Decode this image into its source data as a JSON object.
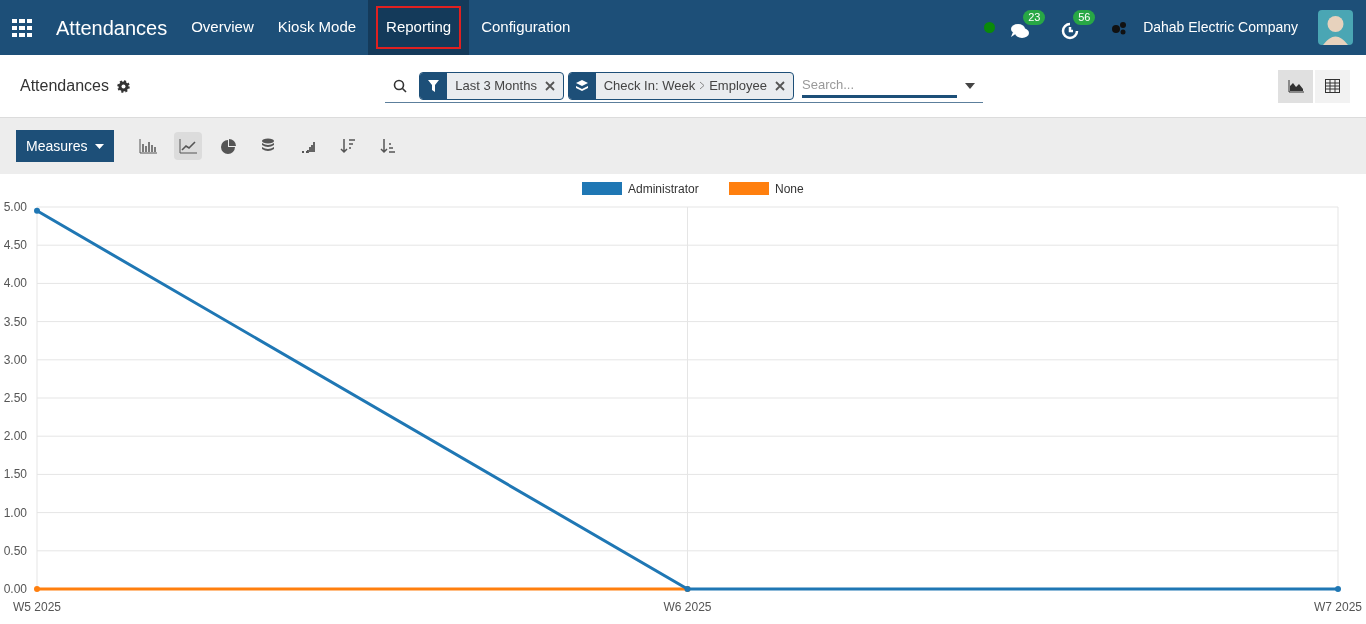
{
  "navbar": {
    "app_title": "Attendances",
    "menu": [
      {
        "label": "Overview",
        "selected": false
      },
      {
        "label": "Kiosk Mode",
        "selected": false
      },
      {
        "label": "Reporting",
        "selected": true
      },
      {
        "label": "Configuration",
        "selected": false
      }
    ],
    "messages_count": "23",
    "activities_count": "56",
    "company": "Dahab Electric Company"
  },
  "control_panel": {
    "breadcrumb": "Attendances",
    "facets": [
      {
        "kind": "filter",
        "label": "Last 3 Months"
      },
      {
        "kind": "groupby",
        "label": "Check In: Week",
        "sub": "Employee"
      }
    ],
    "search": {
      "placeholder": "Search..."
    },
    "views": [
      {
        "kind": "graph",
        "selected": true
      },
      {
        "kind": "pivot",
        "selected": false
      }
    ]
  },
  "toolbar": {
    "measures": "Measures",
    "modes": [
      {
        "kind": "bar",
        "selected": false
      },
      {
        "kind": "line",
        "selected": true
      },
      {
        "kind": "pie",
        "selected": false
      }
    ]
  },
  "chart": {
    "chart_data": {
      "type": "line",
      "grid": true,
      "legend": true,
      "categories": [
        "W5 2025",
        "W6 2025",
        "W7 2025"
      ],
      "series": [
        {
          "name": "Administrator",
          "color": "#1f77b4",
          "marker": "circle",
          "values": [
            4.95,
            0,
            0
          ]
        },
        {
          "name": "None",
          "color": "#ff7f0e",
          "marker": "circle",
          "values": [
            0,
            0,
            null
          ]
        }
      ],
      "ylim": [
        0,
        5
      ],
      "yticks": [
        {
          "value": 0,
          "label": "0.00"
        },
        {
          "value": 0.5,
          "label": "0.50"
        },
        {
          "value": 1,
          "label": "1.00"
        },
        {
          "value": 1.5,
          "label": "1.50"
        },
        {
          "value": 2,
          "label": "2.00"
        },
        {
          "value": 2.5,
          "label": "2.50"
        },
        {
          "value": 3,
          "label": "3.00"
        },
        {
          "value": 3.5,
          "label": "3.50"
        },
        {
          "value": 4,
          "label": "4.00"
        },
        {
          "value": 4.5,
          "label": "4.50"
        },
        {
          "value": 5,
          "label": "5.00"
        }
      ]
    }
  }
}
